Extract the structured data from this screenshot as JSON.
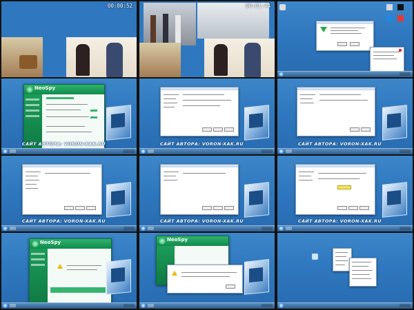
{
  "site_label": "САЙТ АВТОРА: VORON-XAK.RU",
  "timers": [
    "00:00:52",
    "00:01:44"
  ],
  "window_titles": {
    "app": "NeoSpy"
  },
  "colors": {
    "desktop": "#2f78bf",
    "neospy_green": "#1c9c59",
    "taskbar": "#2d5c8c"
  },
  "icons": [
    "desktop-icon",
    "book-cover-icon",
    "warning-icon",
    "download-arrow-icon",
    "start-orb-icon"
  ]
}
